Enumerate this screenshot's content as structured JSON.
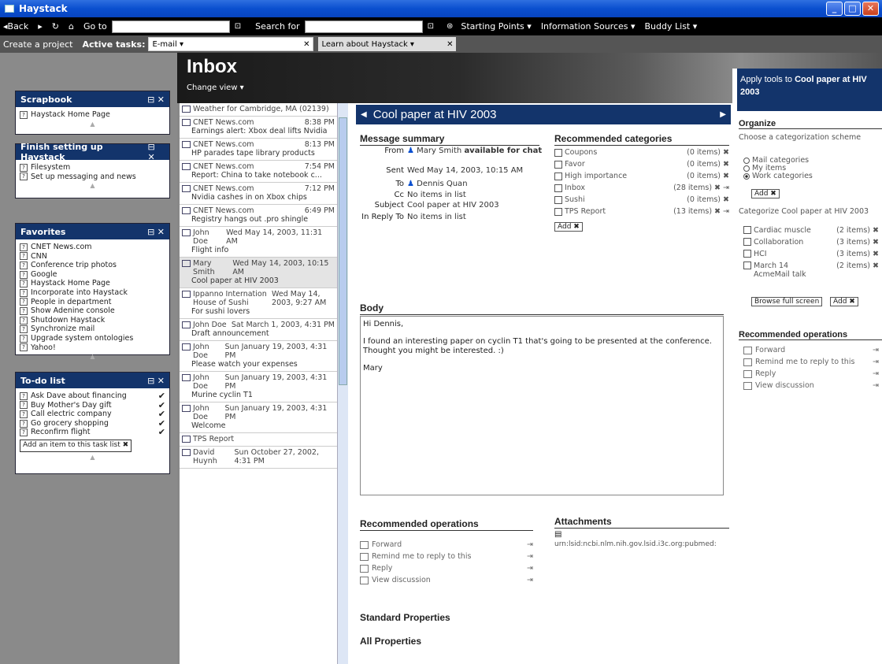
{
  "window": {
    "title": "Haystack"
  },
  "nav": {
    "back": "◂Back",
    "forward": "▸",
    "refresh": "↻",
    "home": "⌂",
    "goto_label": "Go to",
    "goto_value": "",
    "search_label": "Search for",
    "search_value": "",
    "starting_points": "Starting Points ▾",
    "information_sources": "Information Sources ▾",
    "buddy_list": "Buddy List ▾"
  },
  "tasks": {
    "create_project": "Create a project",
    "active_label": "Active tasks:",
    "tab1": "E-mail ▾",
    "tab2": "Learn about Haystack ▾",
    "close": "✕"
  },
  "left": {
    "scrapbook": {
      "title": "Scrapbook",
      "items": [
        "Haystack Home Page"
      ]
    },
    "setup": {
      "title": "Finish setting up Haystack",
      "items": [
        "Filesystem",
        "Set up messaging and news"
      ]
    },
    "favorites": {
      "title": "Favorites",
      "items": [
        "CNET News.com",
        "CNN",
        "Conference trip photos",
        "Google",
        "Haystack Home Page",
        "Incorporate into Haystack",
        "People in department",
        "Show Adenine console",
        "Shutdown Haystack",
        "Synchronize mail",
        "Upgrade system ontologies",
        "Yahoo!"
      ]
    },
    "todo": {
      "title": "To-do list",
      "items": [
        "Ask Dave about financing",
        "Buy Mother's Day gift",
        "Call electric company",
        "Go grocery shopping",
        "Reconfirm flight"
      ],
      "add": "Add an item to this task list ✖"
    },
    "ctrl": "⊟ ✕",
    "check": "✔",
    "foot": "▲"
  },
  "inbox": {
    "title": "Inbox",
    "change_view": "Change view ▾",
    "messages": [
      {
        "from": "Weather for Cambridge, MA (02139)",
        "time": "",
        "subject": ""
      },
      {
        "from": "CNET News.com",
        "time": "8:38 PM",
        "subject": "Earnings alert: Xbox deal lifts Nvidia"
      },
      {
        "from": "CNET News.com",
        "time": "8:13 PM",
        "subject": "HP parades tape library products"
      },
      {
        "from": "CNET News.com",
        "time": "7:54 PM",
        "subject": "Report: China to take notebook c..."
      },
      {
        "from": "CNET News.com",
        "time": "7:12 PM",
        "subject": "Nvidia cashes in on Xbox chips"
      },
      {
        "from": "CNET News.com",
        "time": "6:49 PM",
        "subject": "Registry hangs out .pro shingle"
      },
      {
        "from": "John Doe",
        "time": "Wed May 14, 2003, 11:31 AM",
        "subject": "Flight info"
      },
      {
        "from": "Mary Smith",
        "time": "Wed May 14, 2003, 10:15 AM",
        "subject": "Cool paper at HIV 2003"
      },
      {
        "from": "Ippanno Internation House of Sushi",
        "time": "Wed May 14, 2003, 9:27 AM",
        "subject": "For sushi lovers"
      },
      {
        "from": "John Doe",
        "time": "Sat March 1, 2003, 4:31 PM",
        "subject": "Draft announcement"
      },
      {
        "from": "John Doe",
        "time": "Sun January 19, 2003, 4:31 PM",
        "subject": "Please watch your expenses"
      },
      {
        "from": "John Doe",
        "time": "Sun January 19, 2003, 4:31 PM",
        "subject": "Murine cyclin T1"
      },
      {
        "from": "John Doe",
        "time": "Sun January 19, 2003, 4:31 PM",
        "subject": "Welcome"
      },
      {
        "from": "TPS Report",
        "time": "",
        "subject": ""
      },
      {
        "from": "David Huynh",
        "time": "Sun October 27, 2002, 4:31 PM",
        "subject": ""
      }
    ]
  },
  "message": {
    "title": "Cool paper at HIV 2003",
    "summary_title": "Message summary",
    "labels": {
      "from": "From",
      "sent": "Sent",
      "to": "To",
      "cc": "Cc",
      "subject": "Subject",
      "inreply": "In Reply To"
    },
    "from": "Mary Smith",
    "from_status": "available for chat",
    "sent": "Wed May 14, 2003, 10:15 AM",
    "to": "Dennis Quan",
    "cc": "No items in list",
    "subject": "Cool paper at HIV 2003",
    "inreply": "No items in list",
    "categories_title": "Recommended categories",
    "categories": [
      {
        "name": "Coupons",
        "count": "(0 items) ✖"
      },
      {
        "name": "Favor",
        "count": "(0 items) ✖"
      },
      {
        "name": "High importance",
        "count": "(0 items) ✖"
      },
      {
        "name": "Inbox",
        "count": "(28 items) ✖ ⇥"
      },
      {
        "name": "Sushi",
        "count": "(0 items) ✖"
      },
      {
        "name": "TPS Report",
        "count": "(13 items) ✖ ⇥"
      }
    ],
    "add": "Add ✖",
    "body_title": "Body",
    "body": [
      "Hi Dennis,",
      "I found an interesting paper on cyclin T1 that's going to be presented at the conference. Thought you might be interested. :)",
      "Mary"
    ],
    "ops_title": "Recommended operations",
    "ops": [
      "Forward",
      "Remind me to reply to this",
      "Reply",
      "View discussion"
    ],
    "attach_title": "Attachments",
    "attach": "urn:lsid:ncbi.nlm.nih.gov.lsid.i3c.org:pubmed:",
    "std_props": "Standard Properties",
    "all_props": "All Properties"
  },
  "right": {
    "head_prefix": "Apply tools to ",
    "head_bold": "Cool paper at HIV 2003",
    "organize": "Organize",
    "choose": "Choose a categorization scheme",
    "schemes": [
      "Mail categories",
      "My items",
      "Work categories"
    ],
    "add": "Add ✖",
    "categorize": "Categorize Cool paper at HIV 2003",
    "cats": [
      {
        "name": "Cardiac muscle",
        "count": "(2 items) ✖"
      },
      {
        "name": "Collaboration",
        "count": "(3 items) ✖"
      },
      {
        "name": "HCI",
        "count": "(3 items) ✖"
      },
      {
        "name": "March 14 AcmeMail talk",
        "count": "(2 items) ✖"
      }
    ],
    "browse": "Browse full screen",
    "add2": "Add ✖",
    "ops_title": "Recommended operations",
    "ops": [
      "Forward",
      "Remind me to reply to this",
      "Reply",
      "View discussion"
    ]
  },
  "colors": {
    "accent": "#13346b",
    "titlebar": "#0a4fcf"
  }
}
